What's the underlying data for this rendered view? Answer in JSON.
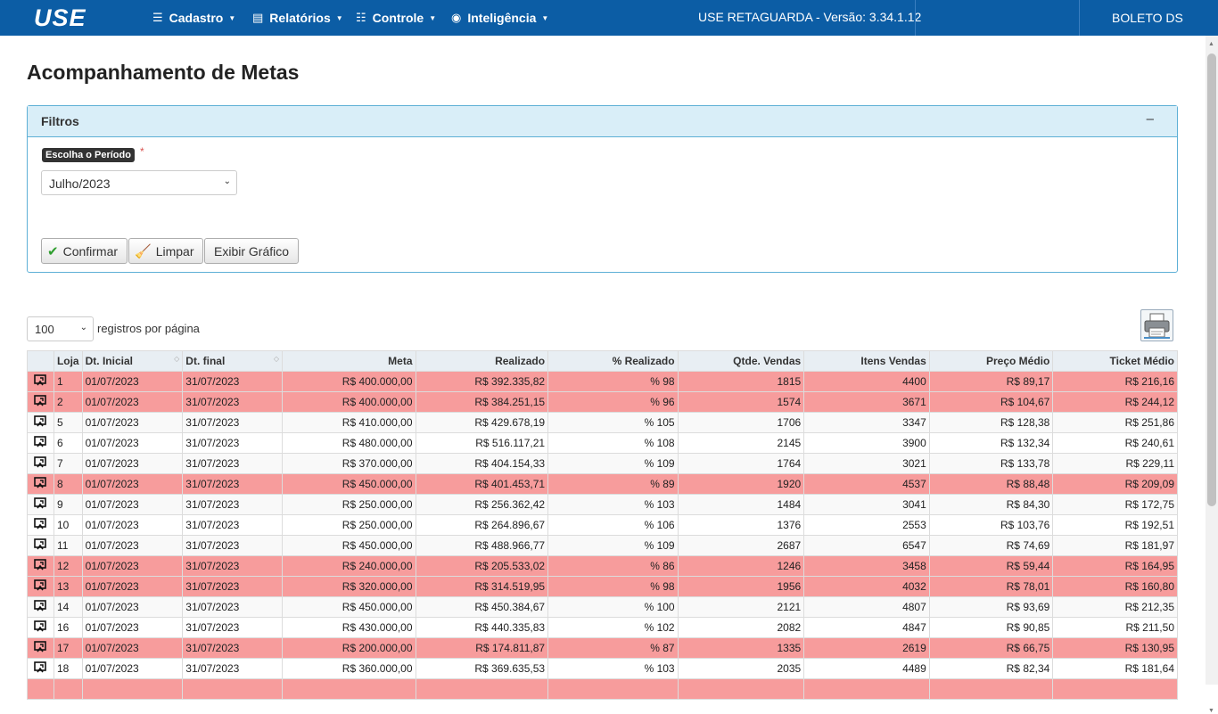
{
  "navbar": {
    "brand": "USE",
    "menus": [
      {
        "label": "Cadastro",
        "icon": "list-check-icon",
        "glyph": "☰"
      },
      {
        "label": "Relatórios",
        "icon": "document-icon",
        "glyph": "▤"
      },
      {
        "label": "Controle",
        "icon": "list-icon",
        "glyph": "☷"
      },
      {
        "label": "Inteligência",
        "icon": "brain-icon",
        "glyph": "◉"
      }
    ],
    "version": "USE RETAGUARDA - Versão: 3.34.1.12",
    "user": "BOLETO DS"
  },
  "page": {
    "title": "Acompanhamento de Metas"
  },
  "filters": {
    "title": "Filtros",
    "collapse": "–",
    "period_label": "Escolha o Período",
    "required_mark": "*",
    "period_value": "Julho/2023",
    "confirm_label": "Confirmar",
    "clear_label": "Limpar",
    "chart_label": "Exibir Gráfico"
  },
  "table_controls": {
    "per_page_value": "100",
    "per_page_label": "registros por página"
  },
  "table": {
    "headers": [
      "",
      "Loja",
      "Dt. Inicial",
      "Dt. final",
      "Meta",
      "Realizado",
      "% Realizado",
      "Qtde. Vendas",
      "Itens Vendas",
      "Preço Médio",
      "Ticket Médio"
    ],
    "rows": [
      {
        "status": "low",
        "loja": "1",
        "ini": "01/07/2023",
        "fim": "31/07/2023",
        "meta": "R$ 400.000,00",
        "realizado": "R$ 392.335,82",
        "pct": "% 98",
        "qtde": "1815",
        "itens": "4400",
        "preco": "R$ 89,17",
        "ticket": "R$ 216,16"
      },
      {
        "status": "low",
        "loja": "2",
        "ini": "01/07/2023",
        "fim": "31/07/2023",
        "meta": "R$ 400.000,00",
        "realizado": "R$ 384.251,15",
        "pct": "% 96",
        "qtde": "1574",
        "itens": "3671",
        "preco": "R$ 104,67",
        "ticket": "R$ 244,12"
      },
      {
        "status": "ok",
        "loja": "5",
        "ini": "01/07/2023",
        "fim": "31/07/2023",
        "meta": "R$ 410.000,00",
        "realizado": "R$ 429.678,19",
        "pct": "% 105",
        "qtde": "1706",
        "itens": "3347",
        "preco": "R$ 128,38",
        "ticket": "R$ 251,86"
      },
      {
        "status": "ok2",
        "loja": "6",
        "ini": "01/07/2023",
        "fim": "31/07/2023",
        "meta": "R$ 480.000,00",
        "realizado": "R$ 516.117,21",
        "pct": "% 108",
        "qtde": "2145",
        "itens": "3900",
        "preco": "R$ 132,34",
        "ticket": "R$ 240,61"
      },
      {
        "status": "ok",
        "loja": "7",
        "ini": "01/07/2023",
        "fim": "31/07/2023",
        "meta": "R$ 370.000,00",
        "realizado": "R$ 404.154,33",
        "pct": "% 109",
        "qtde": "1764",
        "itens": "3021",
        "preco": "R$ 133,78",
        "ticket": "R$ 229,11"
      },
      {
        "status": "low",
        "loja": "8",
        "ini": "01/07/2023",
        "fim": "31/07/2023",
        "meta": "R$ 450.000,00",
        "realizado": "R$ 401.453,71",
        "pct": "% 89",
        "qtde": "1920",
        "itens": "4537",
        "preco": "R$ 88,48",
        "ticket": "R$ 209,09"
      },
      {
        "status": "ok",
        "loja": "9",
        "ini": "01/07/2023",
        "fim": "31/07/2023",
        "meta": "R$ 250.000,00",
        "realizado": "R$ 256.362,42",
        "pct": "% 103",
        "qtde": "1484",
        "itens": "3041",
        "preco": "R$ 84,30",
        "ticket": "R$ 172,75"
      },
      {
        "status": "ok2",
        "loja": "10",
        "ini": "01/07/2023",
        "fim": "31/07/2023",
        "meta": "R$ 250.000,00",
        "realizado": "R$ 264.896,67",
        "pct": "% 106",
        "qtde": "1376",
        "itens": "2553",
        "preco": "R$ 103,76",
        "ticket": "R$ 192,51"
      },
      {
        "status": "ok",
        "loja": "11",
        "ini": "01/07/2023",
        "fim": "31/07/2023",
        "meta": "R$ 450.000,00",
        "realizado": "R$ 488.966,77",
        "pct": "% 109",
        "qtde": "2687",
        "itens": "6547",
        "preco": "R$ 74,69",
        "ticket": "R$ 181,97"
      },
      {
        "status": "low",
        "loja": "12",
        "ini": "01/07/2023",
        "fim": "31/07/2023",
        "meta": "R$ 240.000,00",
        "realizado": "R$ 205.533,02",
        "pct": "% 86",
        "qtde": "1246",
        "itens": "3458",
        "preco": "R$ 59,44",
        "ticket": "R$ 164,95"
      },
      {
        "status": "low",
        "loja": "13",
        "ini": "01/07/2023",
        "fim": "31/07/2023",
        "meta": "R$ 320.000,00",
        "realizado": "R$ 314.519,95",
        "pct": "% 98",
        "qtde": "1956",
        "itens": "4032",
        "preco": "R$ 78,01",
        "ticket": "R$ 160,80"
      },
      {
        "status": "ok",
        "loja": "14",
        "ini": "01/07/2023",
        "fim": "31/07/2023",
        "meta": "R$ 450.000,00",
        "realizado": "R$ 450.384,67",
        "pct": "% 100",
        "qtde": "2121",
        "itens": "4807",
        "preco": "R$ 93,69",
        "ticket": "R$ 212,35"
      },
      {
        "status": "ok2",
        "loja": "16",
        "ini": "01/07/2023",
        "fim": "31/07/2023",
        "meta": "R$ 430.000,00",
        "realizado": "R$ 440.335,83",
        "pct": "% 102",
        "qtde": "2082",
        "itens": "4847",
        "preco": "R$ 90,85",
        "ticket": "R$ 211,50"
      },
      {
        "status": "low",
        "loja": "17",
        "ini": "01/07/2023",
        "fim": "31/07/2023",
        "meta": "R$ 200.000,00",
        "realizado": "R$ 174.811,87",
        "pct": "% 87",
        "qtde": "1335",
        "itens": "2619",
        "preco": "R$ 66,75",
        "ticket": "R$ 130,95"
      },
      {
        "status": "ok2",
        "loja": "18",
        "ini": "01/07/2023",
        "fim": "31/07/2023",
        "meta": "R$ 360.000,00",
        "realizado": "R$ 369.635,53",
        "pct": "% 103",
        "qtde": "2035",
        "itens": "4489",
        "preco": "R$ 82,34",
        "ticket": "R$ 181,64"
      },
      {
        "status": "low",
        "loja": "",
        "ini": "",
        "fim": "",
        "meta": "",
        "realizado": "",
        "pct": "",
        "qtde": "",
        "itens": "",
        "preco": "",
        "ticket": ""
      }
    ]
  },
  "colors": {
    "navbar": "#0c5da5",
    "panel_head": "#d9eef8",
    "row_below_goal": "#f79c9c"
  }
}
